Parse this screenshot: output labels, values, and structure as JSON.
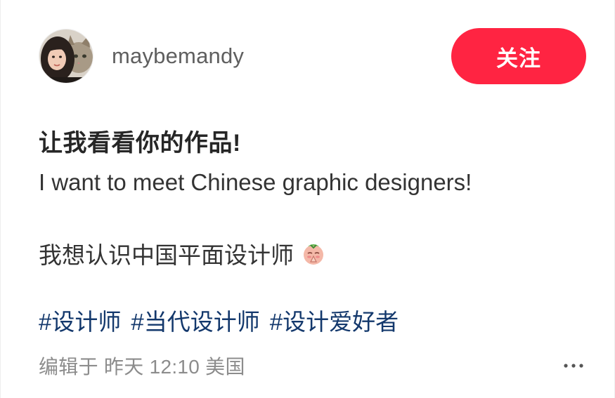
{
  "author": {
    "username": "maybemandy",
    "avatar_icon": "avatar-photo-person-with-cat"
  },
  "follow_button": {
    "label": "关注",
    "color": "#ff2442"
  },
  "post": {
    "title": "让我看看你的作品!",
    "description_en": "I want to meet Chinese graphic designers!",
    "description_zh": "我想认识中国平面设计师",
    "emoji_icon": "pray-emoji-icon",
    "tags": [
      "#设计师",
      "#当代设计师",
      "#设计爱好者"
    ],
    "tag_color": "#13386c"
  },
  "footer": {
    "edit_label": "编辑于",
    "date": "昨天 12:10",
    "location": "美国",
    "more_icon": "more-icon"
  }
}
